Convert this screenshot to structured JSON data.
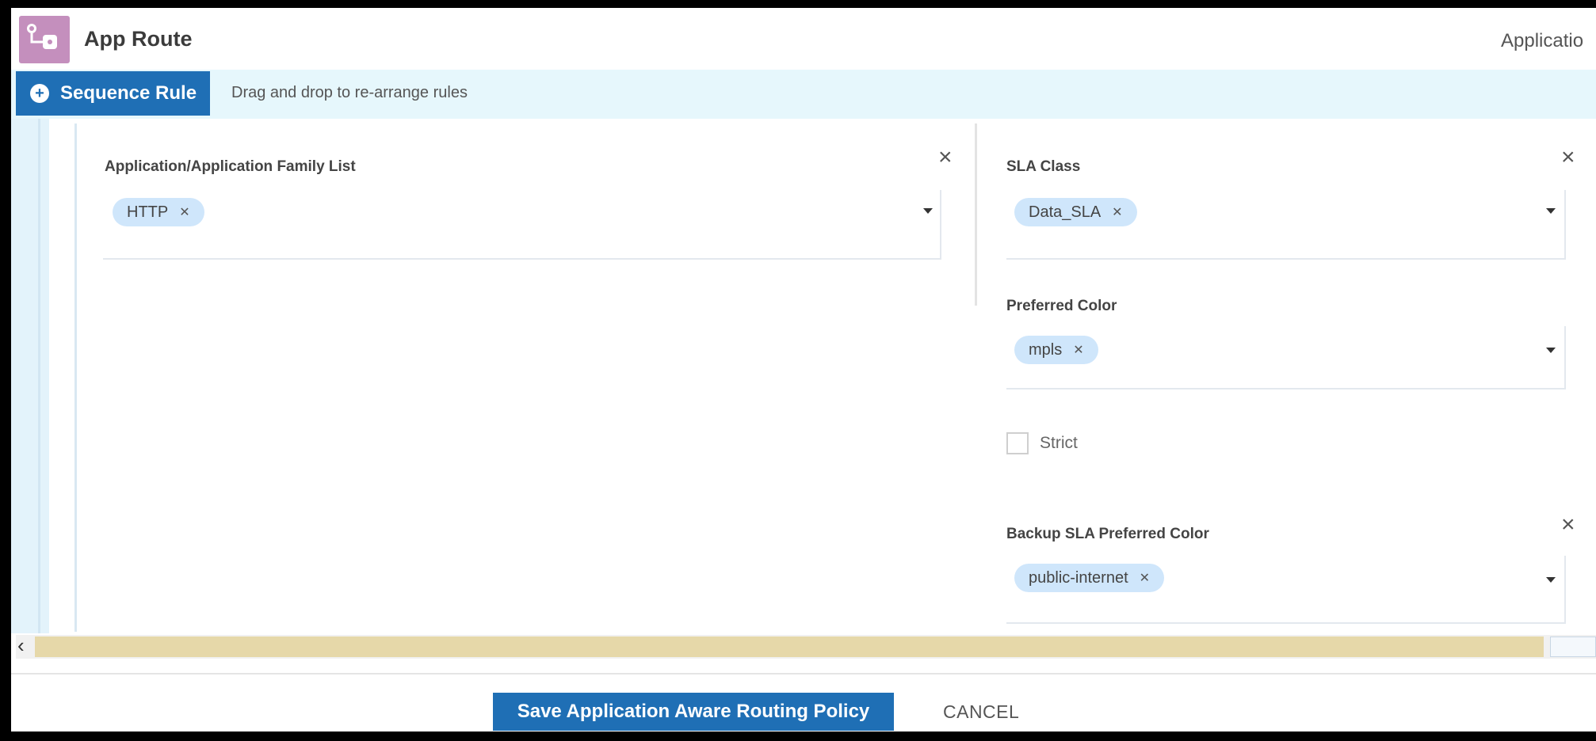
{
  "header": {
    "title": "App Route",
    "right_label": "Applicatio"
  },
  "sequence_bar": {
    "button_label": "Sequence Rule",
    "hint": "Drag and drop to re-arrange rules"
  },
  "match": {
    "app_list_label": "Application/Application Family List",
    "app_list_chips": [
      "HTTP"
    ]
  },
  "actions": {
    "sla_class_label": "SLA Class",
    "sla_class_chips": [
      "Data_SLA"
    ],
    "preferred_color_label": "Preferred Color",
    "preferred_color_chips": [
      "mpls"
    ],
    "strict_label": "Strict",
    "backup_label": "Backup SLA Preferred Color",
    "backup_chips": [
      "public-internet"
    ]
  },
  "footer": {
    "save_label": "Save Application Aware Routing Policy",
    "cancel_label": "CANCEL"
  },
  "icons": {
    "close": "close-icon",
    "remove_chip": "chip-remove-icon",
    "dropdown": "chevron-down-icon",
    "add": "plus-circle-icon",
    "app": "app-route-icon"
  },
  "colors": {
    "primary": "#1f6fb5",
    "chip": "#cfe6fb",
    "sequence_bar_bg": "#e6f7fc",
    "scroll_thumb": "#e6d8a9"
  }
}
